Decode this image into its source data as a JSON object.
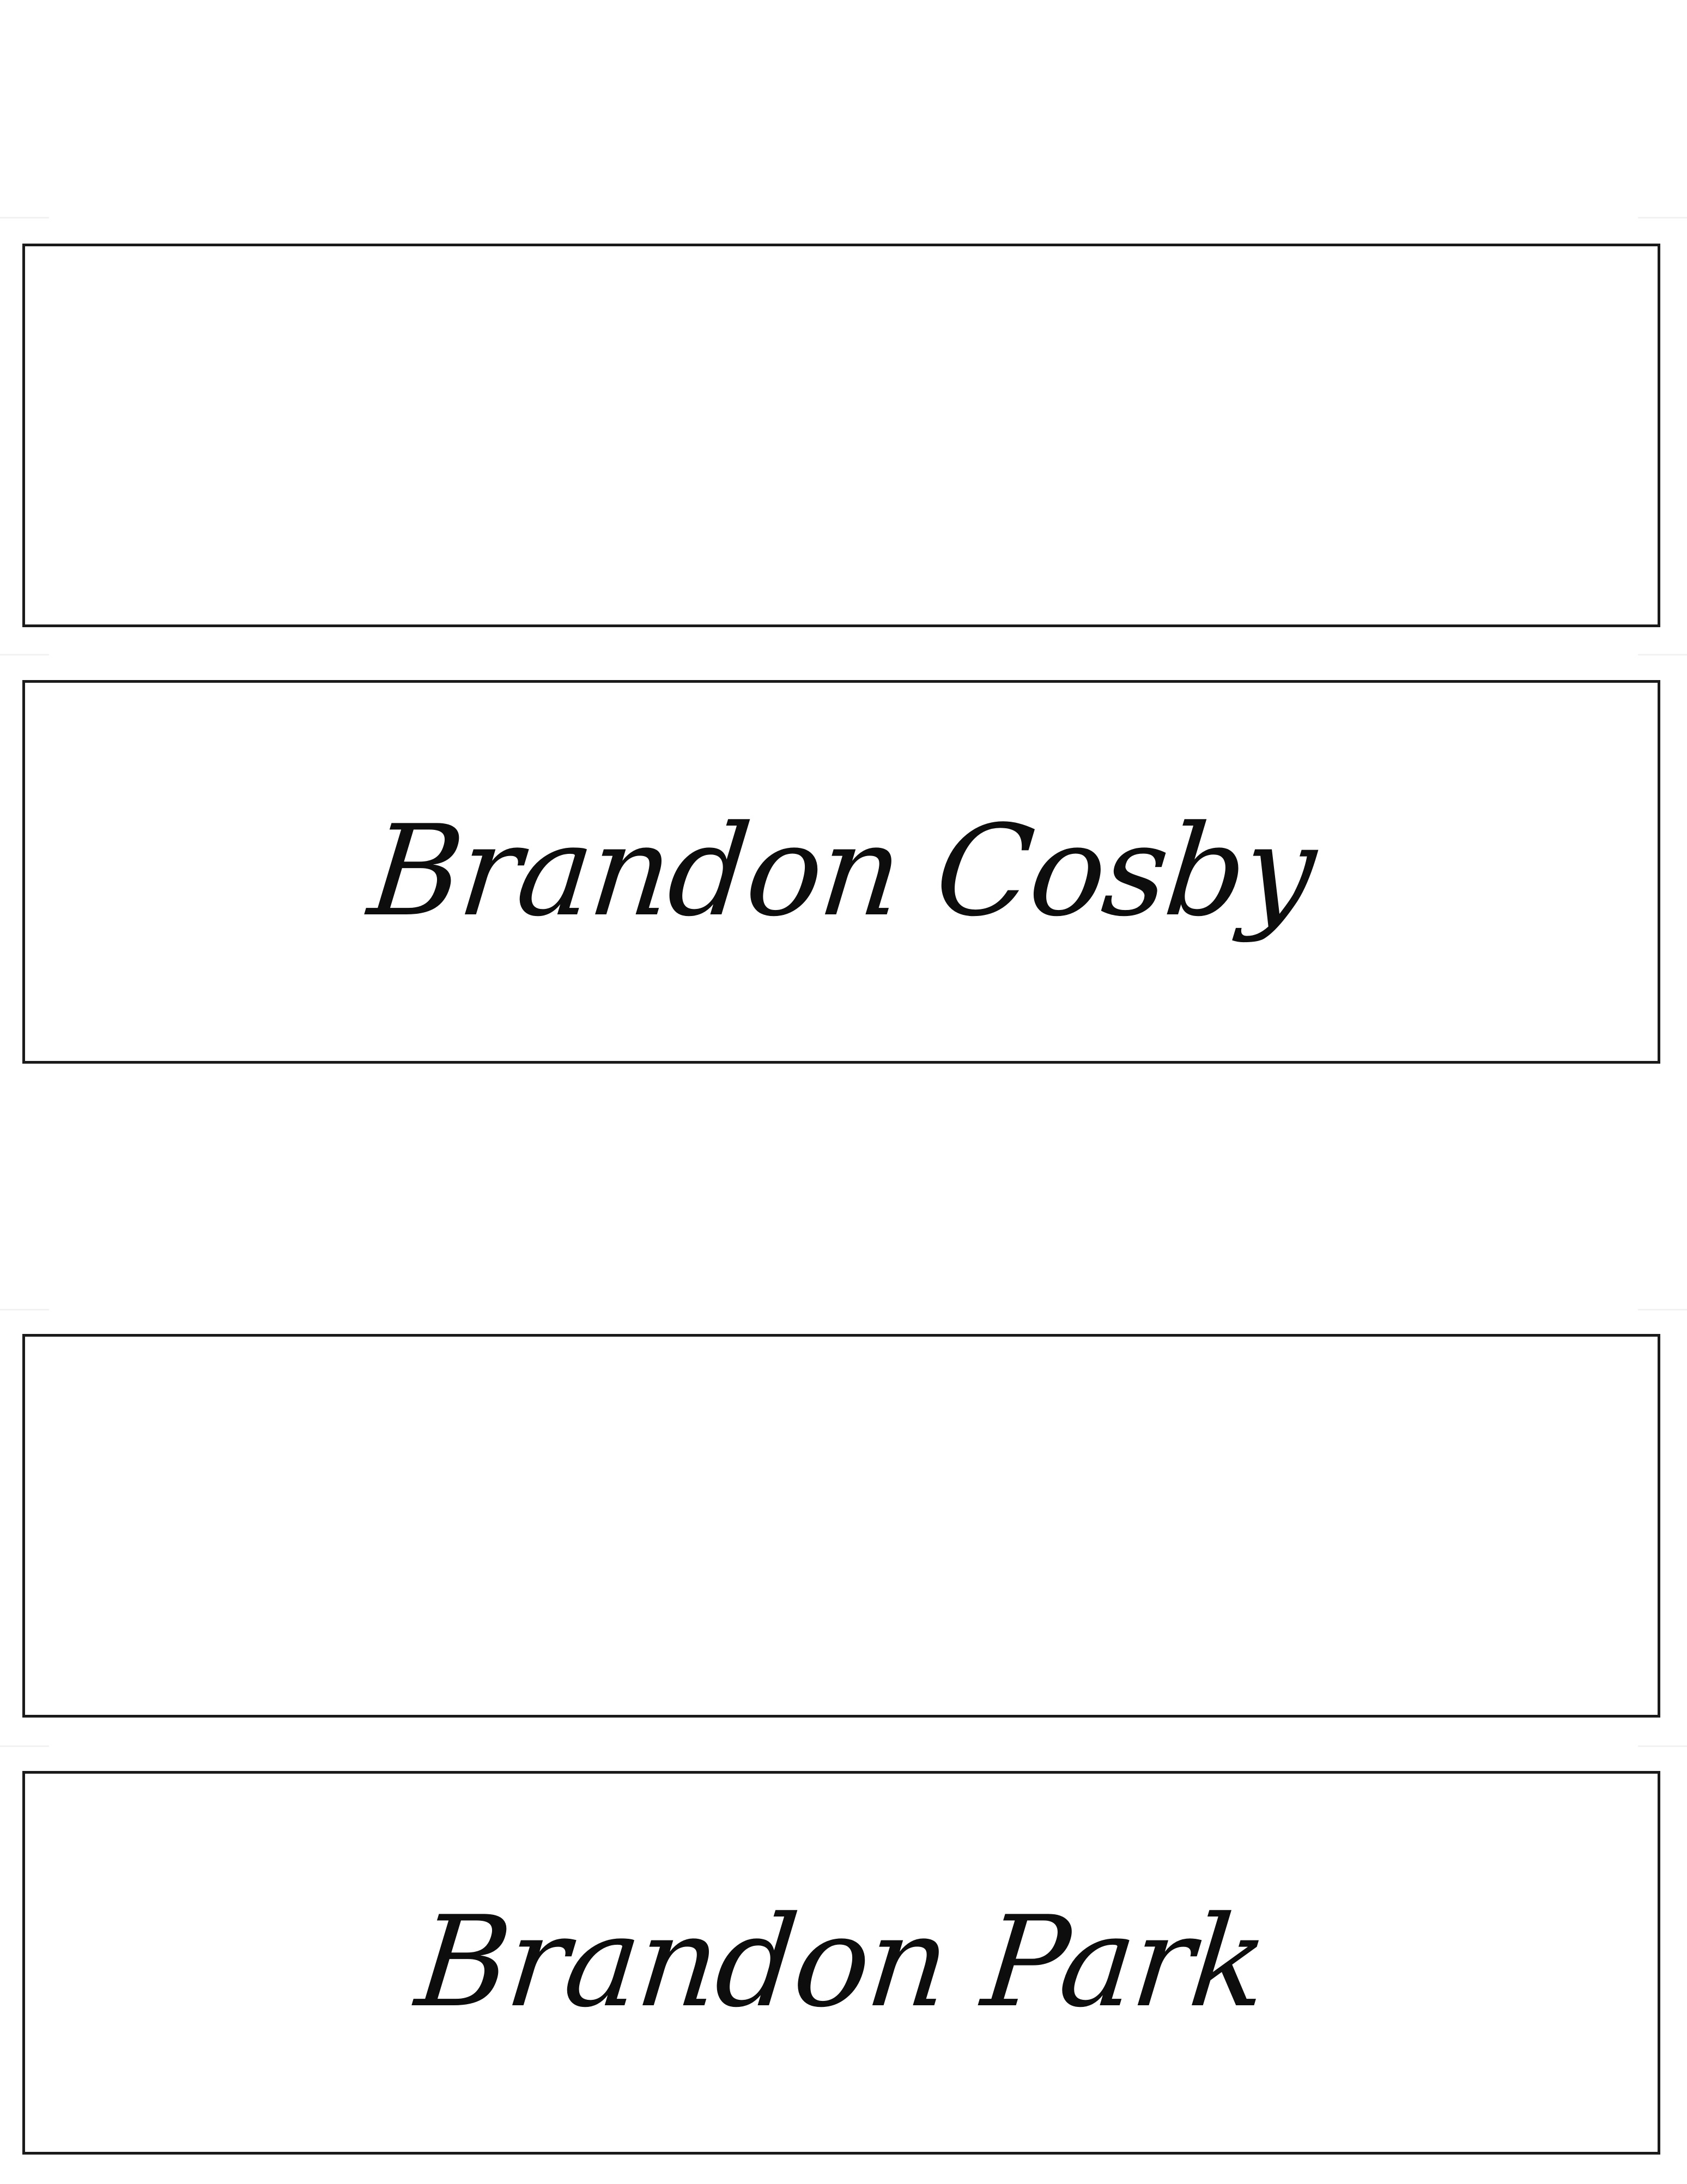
{
  "place_cards": [
    {
      "name": ""
    },
    {
      "name": "Brandon Cosby"
    },
    {
      "name": ""
    },
    {
      "name": "Brandon Park"
    }
  ],
  "colors": {
    "background": "#ffffff",
    "border": "#1a1a1a",
    "text": "#0d0d0d"
  }
}
